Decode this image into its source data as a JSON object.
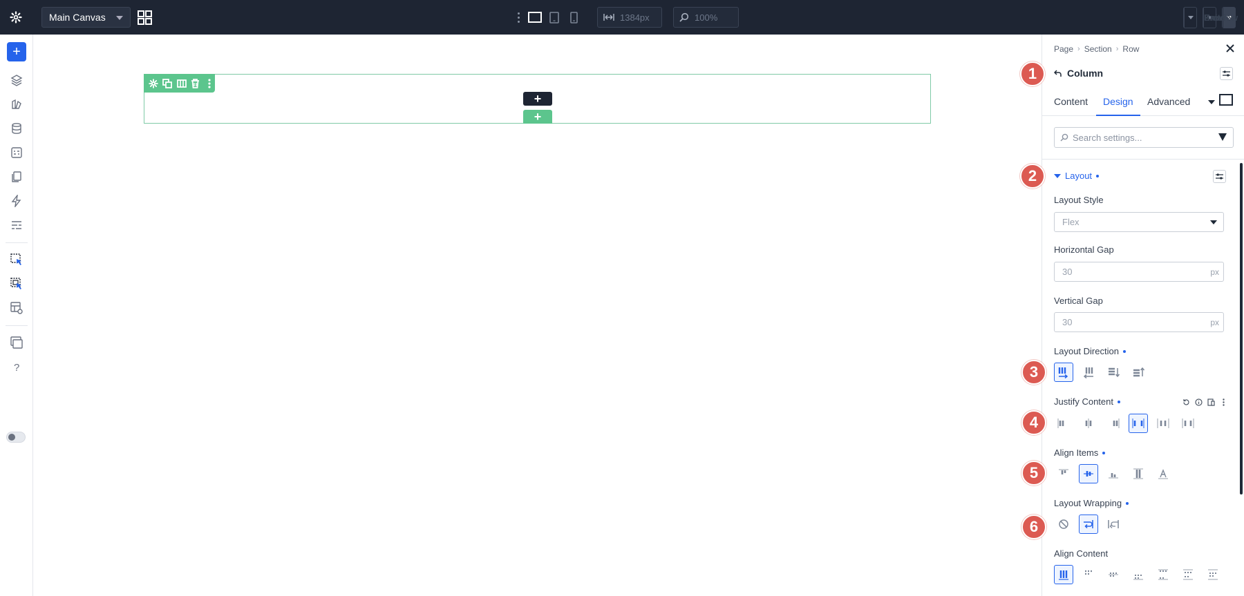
{
  "topbar": {
    "canvas_select": "Main Canvas",
    "width_value": "1384px",
    "zoom_value": "100%",
    "exit_label": "Exit",
    "preview_label": "Preview",
    "save_label": "Save"
  },
  "canvas": {
    "add_label": "+"
  },
  "panel": {
    "breadcrumb": [
      "Page",
      "Section",
      "Row"
    ],
    "title": "Column",
    "tabs": [
      "Content",
      "Design",
      "Advanced"
    ],
    "active_tab": "Design",
    "search_placeholder": "Search settings...",
    "section_title": "Layout",
    "layout_style_label": "Layout Style",
    "layout_style_value": "Flex",
    "horizontal_gap_label": "Horizontal Gap",
    "horizontal_gap_value": "30",
    "vertical_gap_label": "Vertical Gap",
    "vertical_gap_value": "30",
    "unit": "px",
    "layout_direction_label": "Layout Direction",
    "justify_content_label": "Justify Content",
    "align_items_label": "Align Items",
    "layout_wrapping_label": "Layout Wrapping",
    "align_content_label": "Align Content"
  },
  "badges": [
    "1",
    "2",
    "3",
    "4",
    "5",
    "6"
  ],
  "colors": {
    "topbar_bg": "#1e2533",
    "accent": "#2563eb",
    "row_green": "#5cc58d",
    "badge_red": "#dc5a52"
  }
}
